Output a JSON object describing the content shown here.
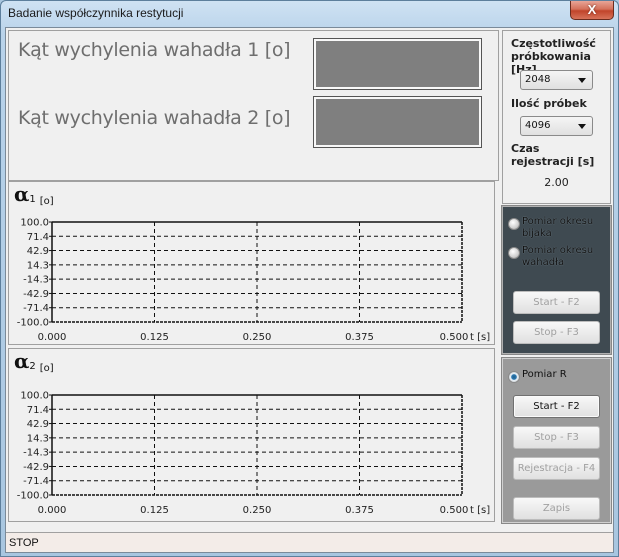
{
  "window": {
    "title": "Badanie współczynnika restytucji",
    "close_label": "X"
  },
  "display": {
    "angle1_label": "Kąt wychylenia wahadła 1 [o]",
    "angle1_value": "",
    "angle2_label": "Kąt wychylenia wahadła 2 [o]",
    "angle2_value": "",
    "box_color": "#7f7f7f"
  },
  "settings": {
    "freq_label": "Częstotliwość próbkowania [Hz]",
    "freq_value": "2048",
    "samples_label": "Ilość próbek",
    "samples_value": "4096",
    "reg_time_label": "Czas rejestracji [s]",
    "reg_time_value": "2.00"
  },
  "period_panel": {
    "color": "#3f4a51",
    "radio1": {
      "label": "Pomiar okresu bijaka",
      "checked": false
    },
    "radio2": {
      "label": "Pomiar okresu wahadła",
      "checked": false
    },
    "start_label": "Start - F2",
    "stop_label": "Stop - F3"
  },
  "r_panel": {
    "color": "#9a9a9a",
    "radio": {
      "label": "Pomiar R",
      "checked": true
    },
    "start_label": "Start - F2",
    "stop_label": "Stop - F3",
    "register_label": "Rejestracja - F4",
    "save_label": "Zapis"
  },
  "status": {
    "text": "STOP"
  },
  "chart_data": [
    {
      "type": "line",
      "title": "α1 [o]",
      "title_symbol": "α",
      "title_sub": "1",
      "title_unit": "[o]",
      "xlabel": "t [s]",
      "ylabel": "",
      "xlim": [
        0.0,
        0.5
      ],
      "ylim": [
        -100.0,
        100.0
      ],
      "x_ticks": [
        "0.000",
        "0.125",
        "0.250",
        "0.375",
        "0.500"
      ],
      "y_ticks": [
        "100.0",
        "71.4",
        "42.9",
        "14.3",
        "-14.3",
        "-42.9",
        "-71.4",
        "-100.0"
      ],
      "grid": true,
      "series": []
    },
    {
      "type": "line",
      "title": "α2 [o]",
      "title_symbol": "α",
      "title_sub": "2",
      "title_unit": "[o]",
      "xlabel": "t [s]",
      "ylabel": "",
      "xlim": [
        0.0,
        0.5
      ],
      "ylim": [
        -100.0,
        100.0
      ],
      "x_ticks": [
        "0.000",
        "0.125",
        "0.250",
        "0.375",
        "0.500"
      ],
      "y_ticks": [
        "100.0",
        "71.4",
        "42.9",
        "14.3",
        "-14.3",
        "-42.9",
        "-71.4",
        "-100.0"
      ],
      "grid": true,
      "series": []
    }
  ]
}
